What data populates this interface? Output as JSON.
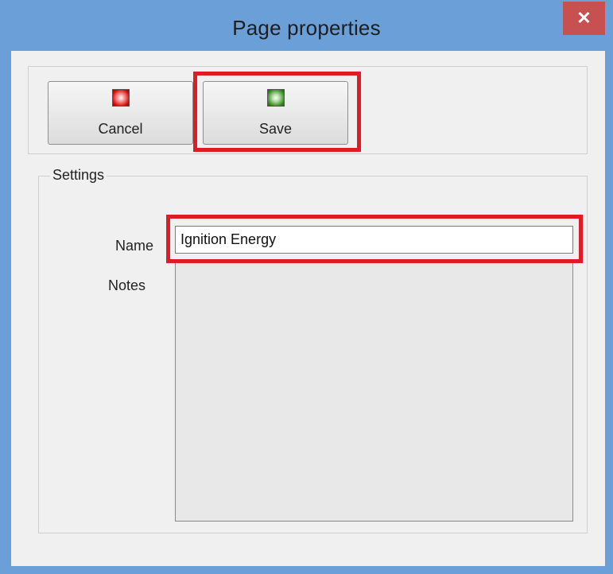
{
  "window": {
    "title": "Page properties",
    "close_glyph": "✕"
  },
  "toolbar": {
    "cancel_label": "Cancel",
    "save_label": "Save",
    "cancel_icon": "red-led-icon",
    "save_icon": "green-led-icon"
  },
  "settings": {
    "group_label": "Settings",
    "name_label": "Name",
    "name_value": "Ignition Energy",
    "notes_label": "Notes",
    "notes_value": ""
  },
  "colors": {
    "title_bar": "#6b9fd8",
    "close_button": "#c75050",
    "highlight": "#e01b24",
    "client": "#f0f0f0"
  }
}
